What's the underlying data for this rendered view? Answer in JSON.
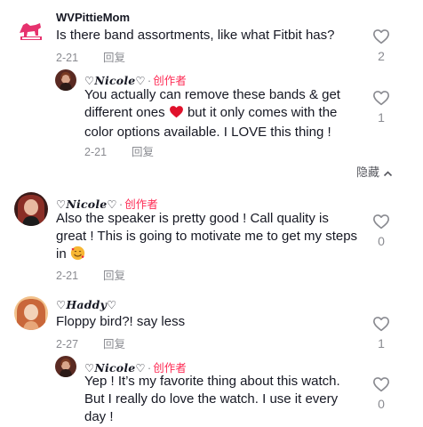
{
  "comments": [
    {
      "username": "WVPittieMom",
      "text": "Is there band assortments, like what Fitbit has?",
      "date": "2-21",
      "reply_label": "回复",
      "likes": "2",
      "avatar_icon": "pink-dog-logo-avatar",
      "replies": [
        {
          "username": "♡𝑵𝒊𝒄𝒐𝒍𝒆♡",
          "creator_badge": "创作者",
          "text_before_emoji": "You actually can remove these bands & get different ones ",
          "text_after_emoji": " but it only comes with the color options available. I LOVE this thing !",
          "date": "2-21",
          "reply_label": "回复",
          "likes": "1",
          "emoji_icon": "red-heart-icon"
        }
      ],
      "hide_label": "隐藏"
    },
    {
      "username": "♡𝑵𝒊𝒄𝒐𝒍𝒆♡",
      "creator_badge": "创作者",
      "text_before_emoji": "Also the speaker is pretty good ! Call quality is great ! This is going to motivate me to get my steps in ",
      "date": "2-21",
      "reply_label": "回复",
      "likes": "0",
      "emoji_icon": "smiling-hearts-emoji"
    },
    {
      "username": "♡𝑯𝒂𝒅𝒅𝒚♡",
      "text": "Floppy bird?! say less",
      "date": "2-27",
      "reply_label": "回复",
      "likes": "1",
      "replies": [
        {
          "username": "♡𝑵𝒊𝒄𝒐𝒍𝒆♡",
          "creator_badge": "创作者",
          "text": "Yep ! It’s my favorite thing about this watch. But I really do love the watch. I use it every day !",
          "likes": "0"
        }
      ]
    }
  ],
  "colors": {
    "creator": "#fe2c55",
    "meta": "#8a8b91",
    "heart_outline": "#8a8b91",
    "text": "#161823"
  }
}
